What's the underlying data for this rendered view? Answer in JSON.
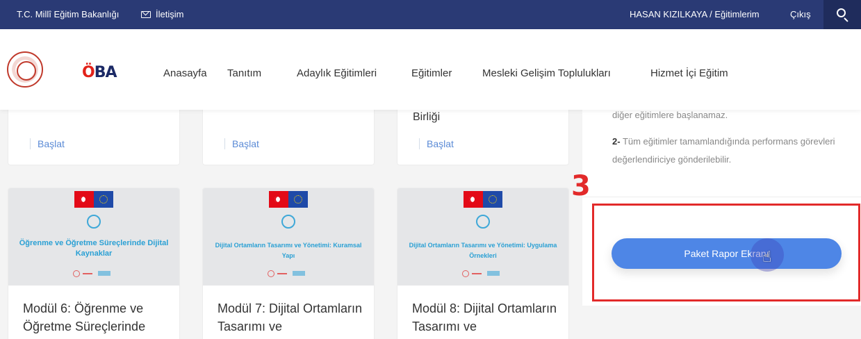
{
  "topbar": {
    "ministry_link": "T.C. Millî Eğitim Bakanlığı",
    "contact_link": "İletişim",
    "user_link": "HASAN KIZILKAYA / Eğitimlerim",
    "logout_link": "Çıkış"
  },
  "brand": {
    "logo_text_o": "Ö",
    "logo_text_rest": "BA"
  },
  "nav": {
    "items": [
      "Anasayfa",
      "Tanıtım",
      "Adaylık Eğitimleri",
      "Eğitimler",
      "Mesleki Gelişim Toplulukları",
      "Hizmet İçi Eğitim"
    ]
  },
  "top_cards": [
    {
      "title_fragment": "",
      "start_label": "Başlat"
    },
    {
      "title_fragment": "",
      "start_label": "Başlat"
    },
    {
      "title_fragment": "Birliği",
      "start_label": "Başlat"
    }
  ],
  "modules": [
    {
      "thumb_title": "Öğrenme ve Öğretme Süreçlerinde Dijital Kaynaklar",
      "title": "Modül 6: Öğrenme ve Öğretme Süreçlerinde"
    },
    {
      "thumb_title": "Dijital Ortamların Tasarımı ve Yönetimi: Kuramsal Yapı",
      "title": "Modül 7: Dijital Ortamların Tasarımı ve"
    },
    {
      "thumb_title": "Dijital Ortamların Tasarımı ve Yönetimi: Uygulama Örnekleri",
      "title": "Modül 8: Dijital Ortamların Tasarımı ve"
    }
  ],
  "sidebar": {
    "line1": "diğer eğitimlere başlanamaz.",
    "line2_num": "2-",
    "line2_text": " Tüm eğitimler tamamlandığında performans görevleri değerlendiriciye gönderilebilir.",
    "report_button": "Paket Rapor Ekranı"
  },
  "annotation": {
    "step": "3",
    "color": "#e22a2a"
  }
}
